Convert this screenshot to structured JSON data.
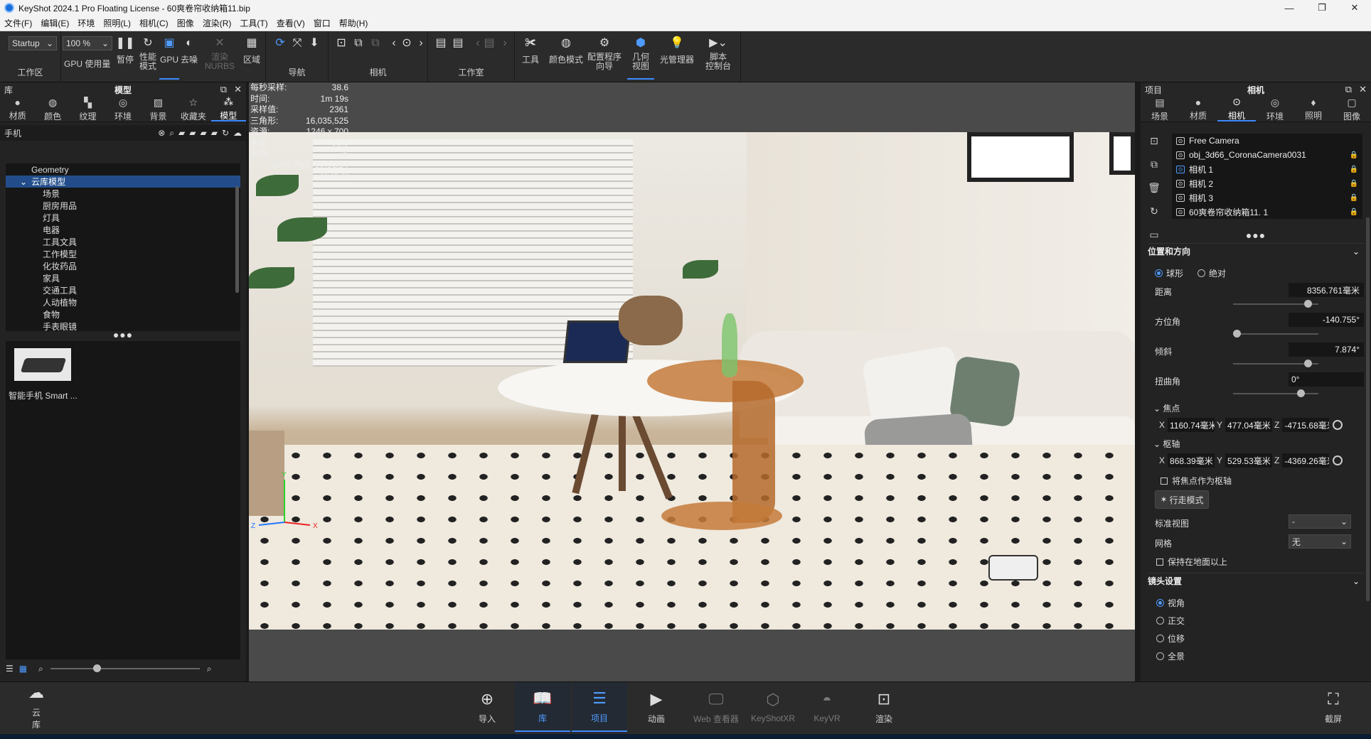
{
  "window": {
    "title": "KeyShot 2024.1 Pro Floating License - 60爽卷帘收纳箱11.bip",
    "min": "—",
    "max": "❐",
    "close": "✕"
  },
  "menu": [
    "文件(F)",
    "编辑(E)",
    "环境",
    "照明(L)",
    "相机(C)",
    "图像",
    "渲染(R)",
    "工具(T)",
    "查看(V)",
    "窗口",
    "帮助(H)"
  ],
  "toolbar": {
    "workspace_select": "Startup",
    "zoom_select": "100 %",
    "workspace_label": "工作区",
    "gpu_usage": "GPU 使用量",
    "pause": "暂停",
    "perf_mode": "性能\n模式",
    "gpu": "GPU",
    "denoise": "去噪",
    "render_nurbs": "渲染\nNURBS",
    "region": "区域",
    "nav_label": "导航",
    "camera_label": "相机",
    "studio_label": "工作室",
    "tools": "工具",
    "color_mode": "颜色模式",
    "config_wizard": "配置程序\n向导",
    "geometry_view": "几何\n视图",
    "light_manager": "光管理器",
    "script_console": "脚本\n控制台"
  },
  "library": {
    "header_left": "库",
    "title": "模型",
    "tabs": [
      "材质",
      "颜色",
      "纹理",
      "环境",
      "背景",
      "收藏夹",
      "模型"
    ],
    "search_value": "手机",
    "tree": {
      "root": "Geometry",
      "selected": "云库模型",
      "items": [
        "场景",
        "厨房用品",
        "灯具",
        "电器",
        "工具文具",
        "工作模型",
        "化妆药品",
        "家具",
        "交通工具",
        "人动植物",
        "食物",
        "手表眼镜"
      ]
    },
    "thumb_label": "智能手机 Smart ..."
  },
  "viewport": {
    "hud": [
      {
        "k": "每秒采样:",
        "v": "38.6"
      },
      {
        "k": "时间:",
        "v": "1m 19s"
      },
      {
        "k": "采样值:",
        "v": "2361"
      },
      {
        "k": "三角形:",
        "v": "16,035,525"
      },
      {
        "k": "资源:",
        "v": "1246 x 700"
      },
      {
        "k": "焦距:",
        "v": "95.0"
      },
      {
        "k": "去噪:",
        "v": "关"
      }
    ],
    "gpu_mem": "GPU 内存: 10.1GB / 16.0GB",
    "axis": {
      "x": "X",
      "y": "Y",
      "z": "Z"
    }
  },
  "project": {
    "header_left": "项目",
    "title": "相机",
    "tabs": [
      "场景",
      "材质",
      "相机",
      "环境",
      "照明",
      "图像"
    ],
    "cameras": [
      "Free Camera",
      "obj_3d66_CoronaCamera0031",
      "相机 1",
      "相机 2",
      "相机 3",
      "60爽卷帘收纳箱11. 1"
    ],
    "pos_section": "位置和方向",
    "mode_spherical": "球形",
    "mode_absolute": "绝对",
    "distance_label": "距离",
    "distance_value": "8356.761毫米",
    "azimuth_label": "方位角",
    "azimuth_value": "-140.755°",
    "incline_label": "倾斜",
    "incline_value": "7.874°",
    "twist_label": "扭曲角",
    "twist_value": "0°",
    "focus_label": "焦点",
    "focus": {
      "x": "1160.74毫米",
      "y": "477.04毫米",
      "z": "-4715.68毫米"
    },
    "pivot_label": "枢轴",
    "pivot": {
      "x": "868.39毫米",
      "y": "529.53毫米",
      "z": "-4369.26毫米"
    },
    "use_focus_pivot": "将焦点作为枢轴",
    "walk_mode": "行走模式",
    "std_view_label": "标准视图",
    "std_view_value": "-",
    "grid_label": "网格",
    "grid_value": "无",
    "keep_above": "保持在地面以上",
    "lens_section": "镜头设置",
    "lens_options": [
      "视角",
      "正交",
      "位移",
      "全景"
    ]
  },
  "bottom": {
    "cloud": "云\n库",
    "buttons": [
      "导入",
      "库",
      "项目",
      "动画",
      "Web 查看器",
      "KeyShotXR",
      "KeyVR",
      "渲染"
    ],
    "screenshot": "截屏"
  }
}
